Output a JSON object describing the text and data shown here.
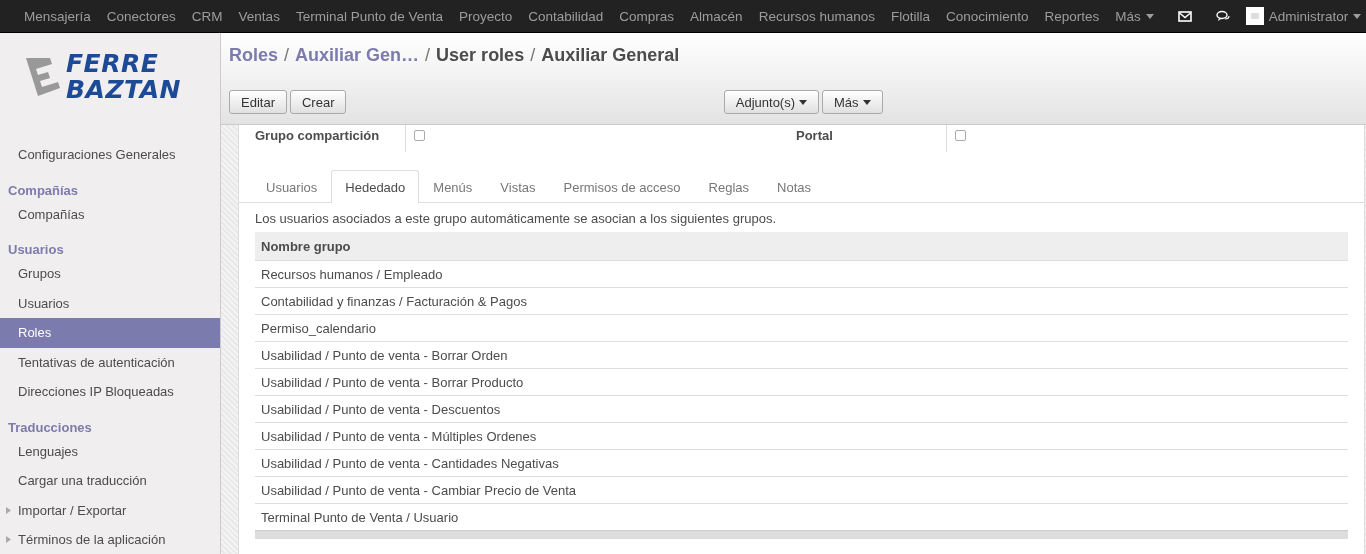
{
  "top_menu": {
    "items": [
      "Mensajería",
      "Conectores",
      "CRM",
      "Ventas",
      "Terminal Punto de Venta",
      "Proyecto",
      "Contabilidad",
      "Compras",
      "Almacén",
      "Recursos humanos",
      "Flotilla",
      "Conocimiento",
      "Reportes",
      "Más"
    ],
    "user": "Administrator"
  },
  "logo": {
    "lines": [
      "FERRE",
      "BAZTAN"
    ]
  },
  "sidebar": {
    "items": [
      {
        "kind": "item",
        "label": "Configuraciones Generales",
        "selected": false
      },
      {
        "kind": "header",
        "label": "Compañías"
      },
      {
        "kind": "item",
        "label": "Compañías",
        "selected": false
      },
      {
        "kind": "header",
        "label": "Usuarios"
      },
      {
        "kind": "item",
        "label": "Grupos",
        "selected": false
      },
      {
        "kind": "item",
        "label": "Usuarios",
        "selected": false
      },
      {
        "kind": "item",
        "label": "Roles",
        "selected": true
      },
      {
        "kind": "item",
        "label": "Tentativas de autenticación",
        "selected": false
      },
      {
        "kind": "item",
        "label": "Direcciones IP Bloqueadas",
        "selected": false
      },
      {
        "kind": "header",
        "label": "Traducciones"
      },
      {
        "kind": "item",
        "label": "Lenguajes",
        "selected": false
      },
      {
        "kind": "item",
        "label": "Cargar una traducción",
        "selected": false
      },
      {
        "kind": "folder",
        "label": "Importar / Exportar",
        "expanded": false
      },
      {
        "kind": "folder",
        "label": "Términos de la aplicación",
        "expanded": false
      }
    ]
  },
  "breadcrumb": [
    {
      "kind": "crumb",
      "label": "Roles",
      "link": true
    },
    {
      "kind": "separator",
      "label": "/"
    },
    {
      "kind": "crumb",
      "label": "Auxiliar Gen…",
      "link": true
    },
    {
      "kind": "separator",
      "label": "/"
    },
    {
      "kind": "crumb",
      "label": "User roles",
      "link": false
    },
    {
      "kind": "separator",
      "label": "/"
    },
    {
      "kind": "crumb",
      "label": "Auxiliar General",
      "link": false
    }
  ],
  "buttons": {
    "left": [
      "Editar",
      "Crear"
    ],
    "center": [
      "Adjunto(s)",
      "Más"
    ]
  },
  "fields": [
    {
      "label": "Grupo compartición",
      "checked": false
    },
    {
      "label": "Portal",
      "checked": false
    }
  ],
  "tabs": [
    {
      "label": "Usuarios",
      "selected": false
    },
    {
      "label": "Hededado",
      "selected": true
    },
    {
      "label": "Menús",
      "selected": false
    },
    {
      "label": "Vistas",
      "selected": false
    },
    {
      "label": "Permisos de acceso",
      "selected": false
    },
    {
      "label": "Reglas",
      "selected": false
    },
    {
      "label": "Notas",
      "selected": false
    }
  ],
  "description": "Los usuarios asociados a este grupo automáticamente se asocian a los siguientes grupos.",
  "table": {
    "columns": [
      "Nombre grupo"
    ],
    "rows": [
      "Recursos humanos / Empleado",
      "Contabilidad y finanzas / Facturación & Pagos",
      "Permiso_calendario",
      "Usabilidad / Punto de venta - Borrar Orden",
      "Usabilidad / Punto de venta - Borrar Producto",
      "Usabilidad / Punto de venta - Descuentos",
      "Usabilidad / Punto de venta - Múltiples Ordenes",
      "Usabilidad / Punto de venta - Cantidades Negativas",
      "Usabilidad / Punto de venta - Cambiar Precio de Venta",
      "Terminal Punto de Venta / Usuario"
    ]
  }
}
